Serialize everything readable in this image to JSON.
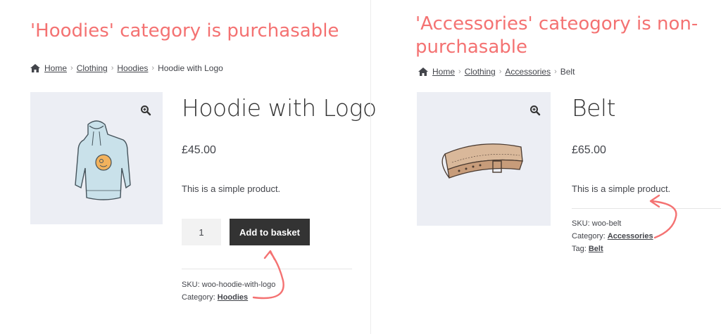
{
  "left": {
    "annotation": "'Hoodies' category is purchasable",
    "breadcrumb": {
      "home": "Home",
      "level1": "Clothing",
      "level2": "Hoodies",
      "current": "Hoodie with Logo",
      "separator": "›"
    },
    "product": {
      "title": "Hoodie with Logo",
      "price": "£45.00",
      "description": "This is a simple product.",
      "quantity": "1",
      "add_button": "Add to basket",
      "sku_label": "SKU:",
      "sku_value": "woo-hoodie-with-logo",
      "category_label": "Category:",
      "category_value": "Hoodies"
    }
  },
  "right": {
    "annotation_line1": "'Accessories' cateogory is non-",
    "annotation_line2": "purchasable",
    "breadcrumb": {
      "home": "Home",
      "level1": "Clothing",
      "level2": "Accessories",
      "current": "Belt",
      "separator": "›"
    },
    "product": {
      "title": "Belt",
      "price": "£65.00",
      "description": "This is a simple product.",
      "sku_label": "SKU:",
      "sku_value": "woo-belt",
      "category_label": "Category:",
      "category_value": "Accessories",
      "tag_label": "Tag:",
      "tag_value": "Belt"
    }
  },
  "colors": {
    "annotation": "#f47272",
    "button": "#333333",
    "image_bg": "#eceef4"
  },
  "icons": {
    "home": "home-icon",
    "zoom": "magnifier-zoom-icon",
    "arrow": "curved-arrow-annotation"
  }
}
